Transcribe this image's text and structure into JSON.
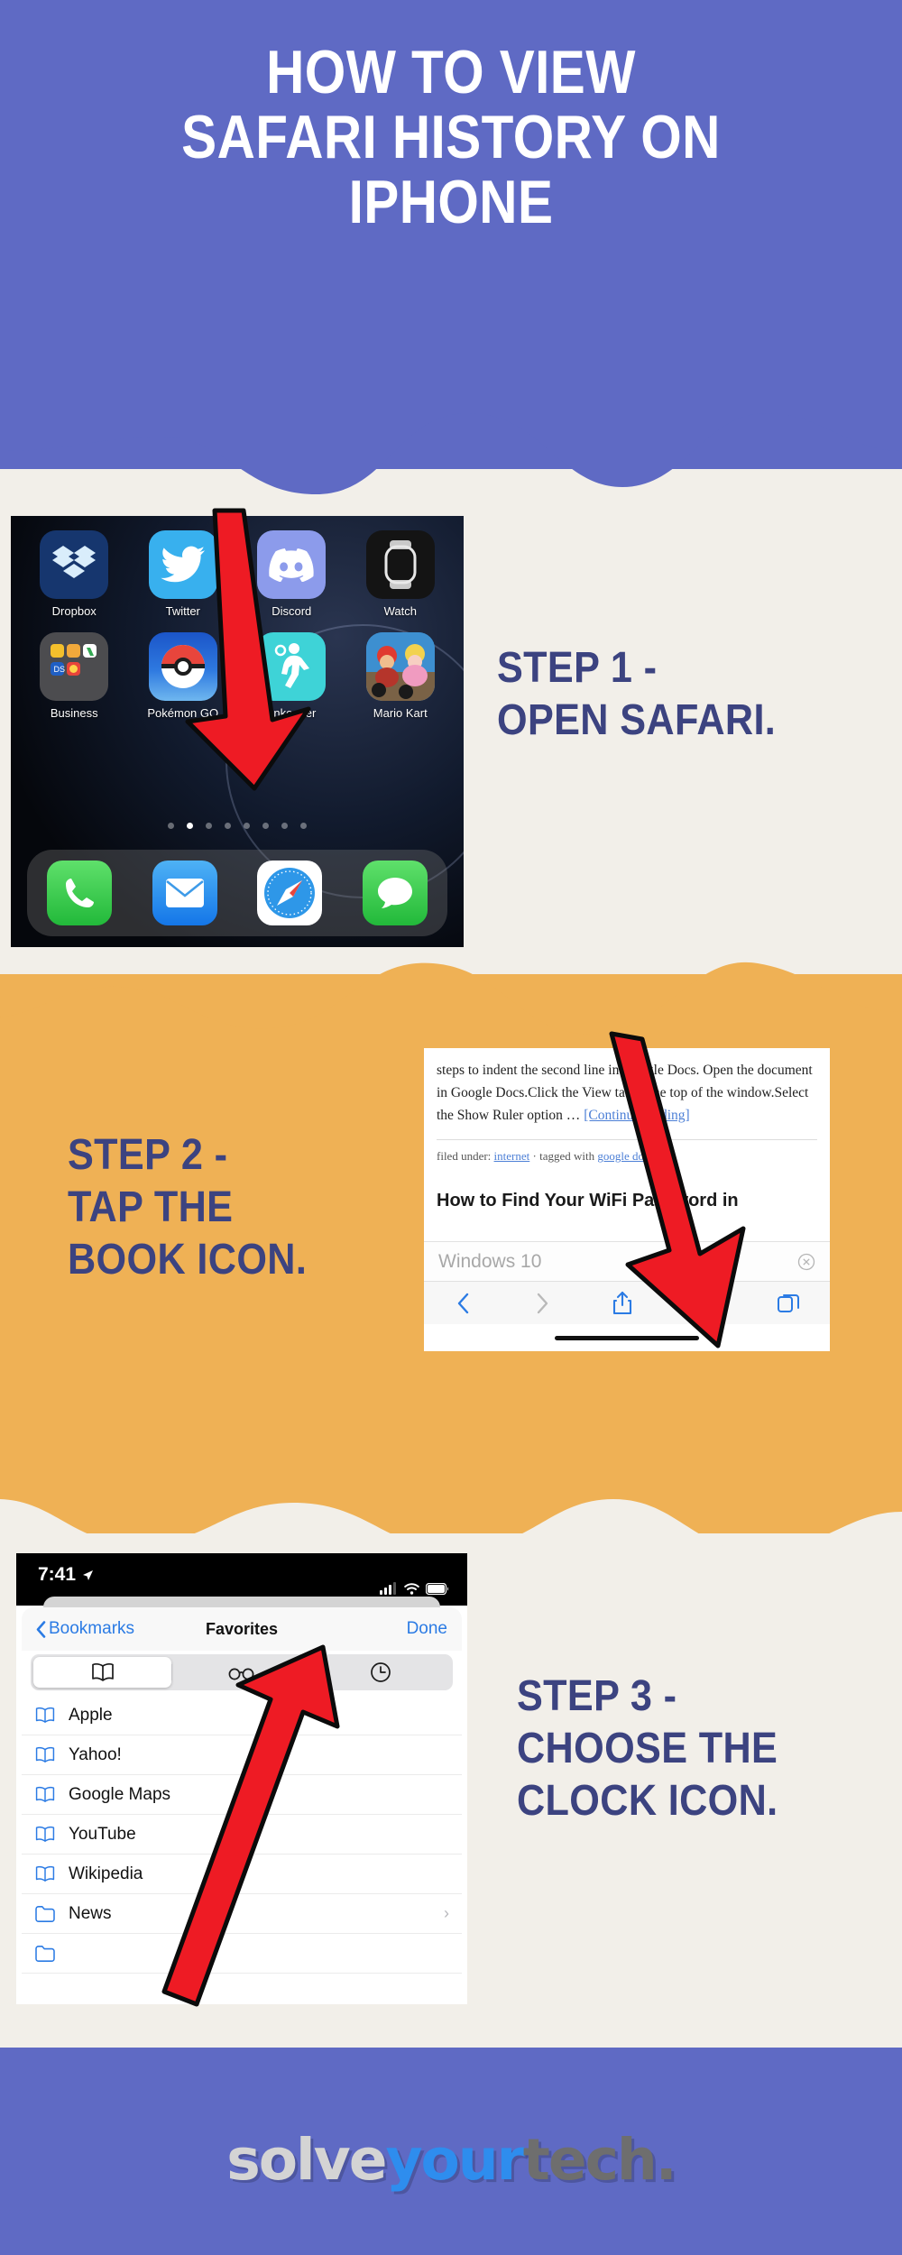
{
  "theme": {
    "purple": "#5F6AC4",
    "cream": "#F2EFE9",
    "orange": "#EFB155",
    "navy_text": "#3C4380",
    "arrow_red": "#EE1B24"
  },
  "header": {
    "title_lines": [
      "HOW TO VIEW",
      "SAFARI HISTORY ON",
      "IPHONE"
    ]
  },
  "steps": [
    {
      "id": "step-1",
      "caption_lines": [
        "STEP 1 -",
        "OPEN SAFARI."
      ]
    },
    {
      "id": "step-2",
      "caption_lines": [
        "STEP 2 -",
        "TAP THE",
        "BOOK ICON."
      ]
    },
    {
      "id": "step-3",
      "caption_lines": [
        "STEP 3 -",
        "CHOOSE THE",
        "CLOCK ICON."
      ]
    }
  ],
  "home_screen": {
    "apps": [
      {
        "label": "Dropbox",
        "icon": "dropbox-icon"
      },
      {
        "label": "Twitter",
        "icon": "twitter-icon"
      },
      {
        "label": "Discord",
        "icon": "discord-icon"
      },
      {
        "label": "Watch",
        "icon": "watch-icon"
      },
      {
        "label": "Business",
        "icon": "folder-business-icon"
      },
      {
        "label": "Pokémon GO",
        "icon": "pokemon-go-icon"
      },
      {
        "label": "unkeeper",
        "icon": "runkeeper-icon"
      },
      {
        "label": "Mario Kart",
        "icon": "mario-kart-icon"
      }
    ],
    "page_dots": {
      "count": 8,
      "active_index": 1
    },
    "dock": [
      {
        "label": "Phone",
        "icon": "phone-icon"
      },
      {
        "label": "Mail",
        "icon": "mail-icon"
      },
      {
        "label": "Safari",
        "icon": "safari-compass-icon"
      },
      {
        "label": "Messages",
        "icon": "messages-icon"
      }
    ]
  },
  "safari_page": {
    "paragraph_pre": "steps to indent the second line in Google Docs. Open the document in Google Docs.Click the View tab at the top of the window.Select the Show Ruler option … ",
    "continue_link": "[Continue reading]",
    "meta_prefix": "filed under: ",
    "meta_category": "internet",
    "meta_sep": " · tagged with ",
    "meta_tag": "google docs",
    "next_post_title": "How to Find Your WiFi Password in",
    "url_text": "Windows 10",
    "toolbar": [
      {
        "name": "back-icon",
        "state": "enabled"
      },
      {
        "name": "forward-icon",
        "state": "disabled"
      },
      {
        "name": "share-icon",
        "state": "enabled"
      },
      {
        "name": "bookmarks-book-icon",
        "state": "enabled"
      },
      {
        "name": "tabs-icon",
        "state": "enabled"
      }
    ],
    "clear_button": "clear-x-icon"
  },
  "bookmarks_screen": {
    "status_bar": {
      "time": "7:41",
      "location_icon": "location-arrow-icon",
      "cellular_icon": "cellular-bars-icon",
      "wifi_icon": "wifi-icon",
      "battery_icon": "battery-icon"
    },
    "nav": {
      "back_label": "Bookmarks",
      "title": "Favorites",
      "done_label": "Done"
    },
    "segments": [
      {
        "name": "bookmarks-book-icon",
        "active": true
      },
      {
        "name": "reading-list-glasses-icon",
        "active": false
      },
      {
        "name": "history-clock-icon",
        "active": false
      }
    ],
    "items": [
      {
        "label": "Apple",
        "icon": "bookmark-book-icon",
        "chevron": false
      },
      {
        "label": "Yahoo!",
        "icon": "bookmark-book-icon",
        "chevron": false
      },
      {
        "label": "Google Maps",
        "icon": "bookmark-book-icon",
        "chevron": false
      },
      {
        "label": "YouTube",
        "icon": "bookmark-book-icon",
        "chevron": false
      },
      {
        "label": "Wikipedia",
        "icon": "bookmark-book-icon",
        "chevron": false
      },
      {
        "label": "News",
        "icon": "folder-icon",
        "chevron": true
      }
    ],
    "chevron_glyph": "›"
  },
  "footer": {
    "logo_parts": [
      "solve",
      "your",
      "tech."
    ]
  }
}
